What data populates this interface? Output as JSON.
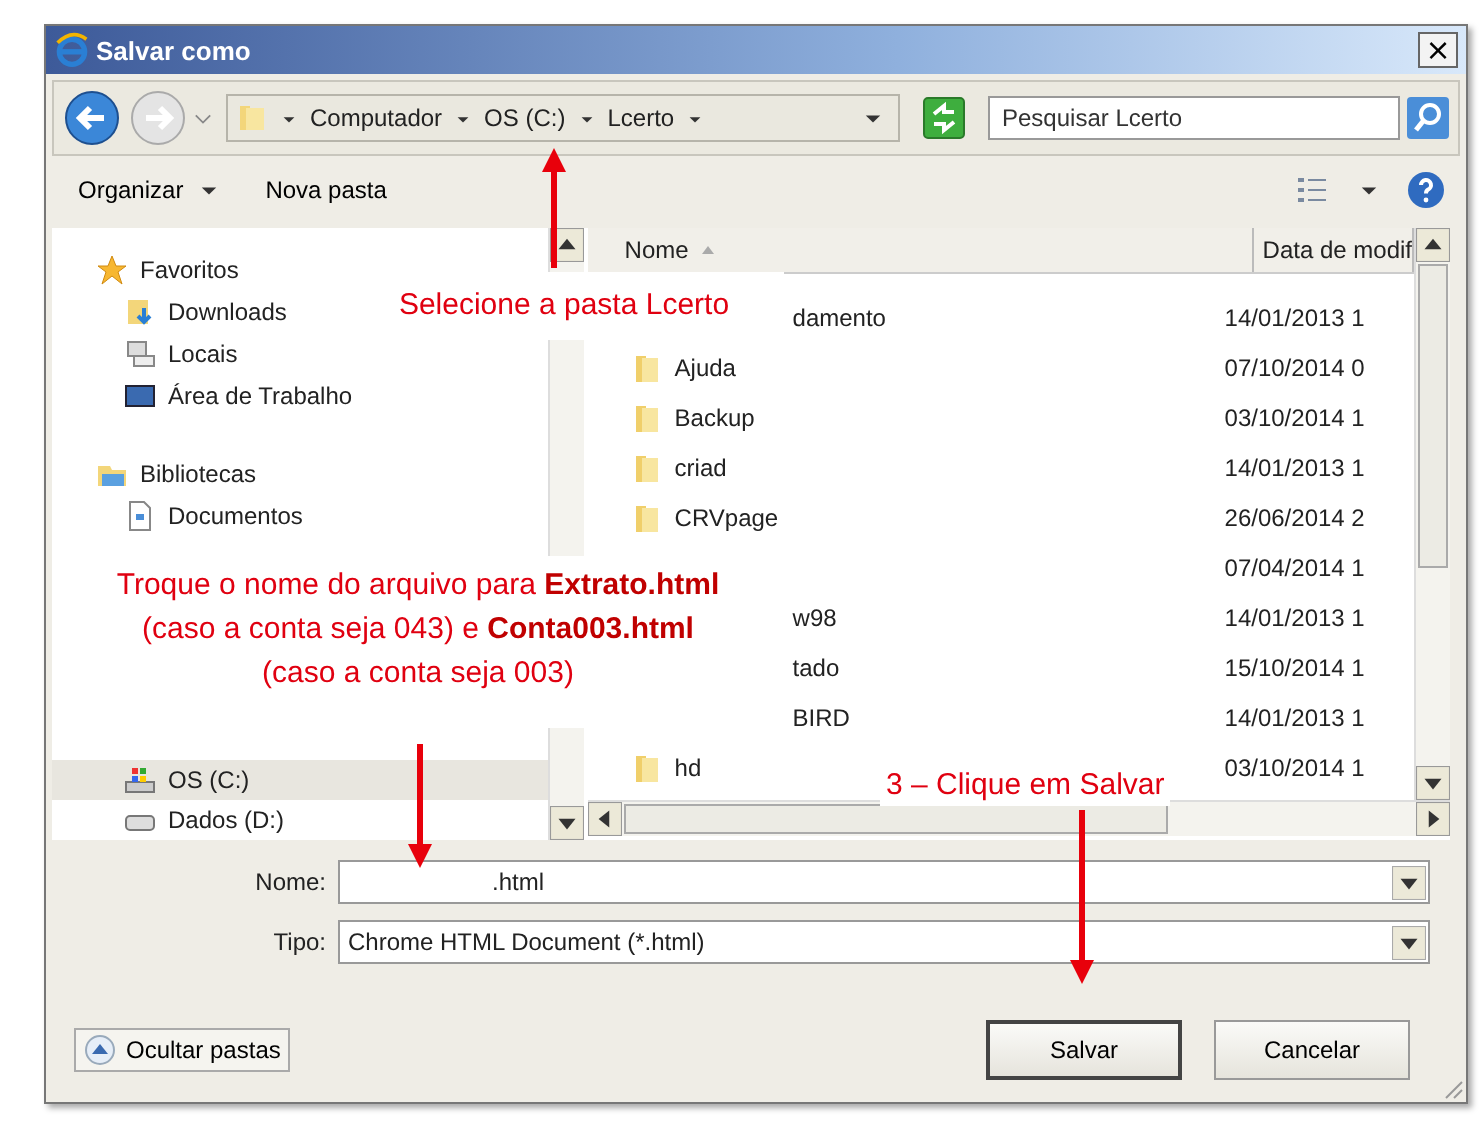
{
  "window": {
    "title": "Salvar como",
    "close": "×"
  },
  "address": {
    "breadcrumbs": [
      "Computador",
      "OS (C:)",
      "Lcerto"
    ]
  },
  "search": {
    "placeholder": "Pesquisar Lcerto"
  },
  "toolbar": {
    "items": [
      "Organizar",
      "Nova pasta"
    ]
  },
  "navigation": [
    {
      "label": "Favoritos",
      "kind": "star",
      "children": [
        {
          "label": "Downloads",
          "kind": "downloads",
          "selected": false
        },
        {
          "label": "Locais",
          "kind": "places",
          "selected": false
        },
        {
          "label": "Área de Trabalho",
          "kind": "desktop",
          "selected": false
        }
      ]
    },
    {
      "label": "Bibliotecas",
      "kind": "library",
      "children": [
        {
          "label": "Documentos",
          "kind": "document",
          "selected": false
        }
      ]
    }
  ],
  "drives": [
    {
      "label": "OS (C:)",
      "kind": "system",
      "selected": true
    },
    {
      "label": "Dados (D:)",
      "kind": "disk",
      "selected": false
    }
  ],
  "file_list": {
    "columns": [
      {
        "label": "Nome",
        "sorted": true
      },
      {
        "label": "Data de modif",
        "sorted": false
      }
    ],
    "rows": [
      {
        "name": "damento",
        "date": "14/01/2013 1",
        "kind": "covered"
      },
      {
        "name": "Ajuda",
        "date": "07/10/2014 0",
        "kind": "folder"
      },
      {
        "name": "Backup",
        "date": "03/10/2014 1",
        "kind": "folder"
      },
      {
        "name": "criad",
        "date": "14/01/2013 1",
        "kind": "folder"
      },
      {
        "name": "CRVpage",
        "date": "26/06/2014 2",
        "kind": "folder"
      },
      {
        "date": "07/04/2014 1",
        "kind": "covered"
      },
      {
        "name": "w98",
        "date": "14/01/2013 1",
        "kind": "covered"
      },
      {
        "name": "tado",
        "date": "15/10/2014 1",
        "kind": "covered"
      },
      {
        "name": "BIRD",
        "date": "14/01/2013 1",
        "kind": "covered"
      },
      {
        "name": "hd",
        "date": "03/10/2014 1",
        "kind": "folder"
      }
    ]
  },
  "form": [
    {
      "label": "Nome:",
      "value": ".html"
    },
    {
      "label": "Tipo:",
      "value": "Chrome HTML Document (*.html)"
    }
  ],
  "hide_folders": "Ocultar pastas",
  "buttons": [
    {
      "label": "Salvar",
      "default": true
    },
    {
      "label": "Cancelar",
      "default": false
    }
  ],
  "annotations": [
    {
      "kind": "select",
      "text": "Selecione a pasta Lcerto"
    },
    {
      "kind": "rename",
      "text": "Troque o nome do arquivo para **Extrato.html**\n(caso a conta seja 043) e **Conta003.html**\n(caso a conta seja 003)"
    },
    {
      "kind": "save",
      "text": "3 – Clique em Salvar"
    }
  ]
}
